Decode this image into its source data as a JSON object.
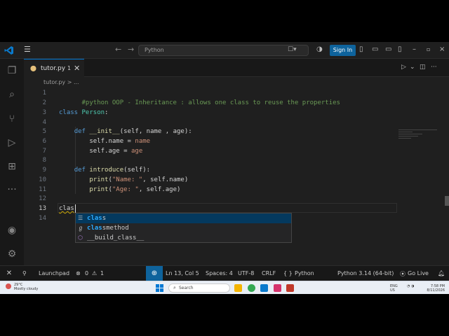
{
  "titlebar": {
    "menu_icon": "hamburger-icon",
    "back_icon": "arrow-left-icon",
    "forward_icon": "arrow-right-icon",
    "search_text": "Python",
    "sign_in": "Sign In"
  },
  "tab": {
    "name": "tutor.py",
    "modified_count": "1"
  },
  "breadcrumb": "tutor.py > ...",
  "editor": {
    "lines": [
      {
        "n": "1"
      },
      {
        "n": "2"
      },
      {
        "n": "3"
      },
      {
        "n": "4"
      },
      {
        "n": "5"
      },
      {
        "n": "6"
      },
      {
        "n": "7"
      },
      {
        "n": "8"
      },
      {
        "n": "9"
      },
      {
        "n": "10"
      },
      {
        "n": "11"
      },
      {
        "n": "12"
      },
      {
        "n": "13"
      },
      {
        "n": "14"
      }
    ],
    "code": {
      "l1": "#python OOP - Inheritance : allows one class to reuse the properties",
      "l3_kw": "class",
      "l3_name": "Person",
      "l3_colon": ":",
      "l5_kw": "def",
      "l5_fn": "__init__",
      "l5_args": "(self, name , age):",
      "l6_a": "self.name",
      "l6_eq": " = ",
      "l6_b": "name",
      "l7_a": "self.age",
      "l7_eq": " = ",
      "l7_b": "age",
      "l9_kw": "def",
      "l9_fn": "introduce",
      "l9_args": "(self):",
      "l10_fn": "print",
      "l10_open": "(",
      "l10_str": "\"Name: \"",
      "l10_rest": ", self.name)",
      "l11_fn": "print",
      "l11_open": "(",
      "l11_str": "\"Age: \"",
      "l11_rest": ", self.age)",
      "l13": "clas"
    }
  },
  "suggestions": [
    {
      "match": "clas",
      "rest": "s",
      "icon": "keyword-icon"
    },
    {
      "match": "clas",
      "rest": "smethod",
      "icon": "function-icon"
    },
    {
      "match": "",
      "rest": "__build_class__",
      "icon": "cube-icon"
    }
  ],
  "status": {
    "launchpad": "Launchpad",
    "errors": "0",
    "warnings": "1",
    "position": "Ln 13, Col 5",
    "spaces": "Spaces: 4",
    "encoding": "UTF-8",
    "eol": "CRLF",
    "language": "Python",
    "interpreter": "Python 3.14 (64-bit)",
    "golive": "Go Live"
  },
  "taskbar": {
    "weather_temp": "29°C",
    "weather_desc": "Mostly cloudy",
    "search": "Search",
    "lang1": "ENG",
    "lang2": "US",
    "time": "7:58 PM",
    "date": "8/11/2026"
  }
}
